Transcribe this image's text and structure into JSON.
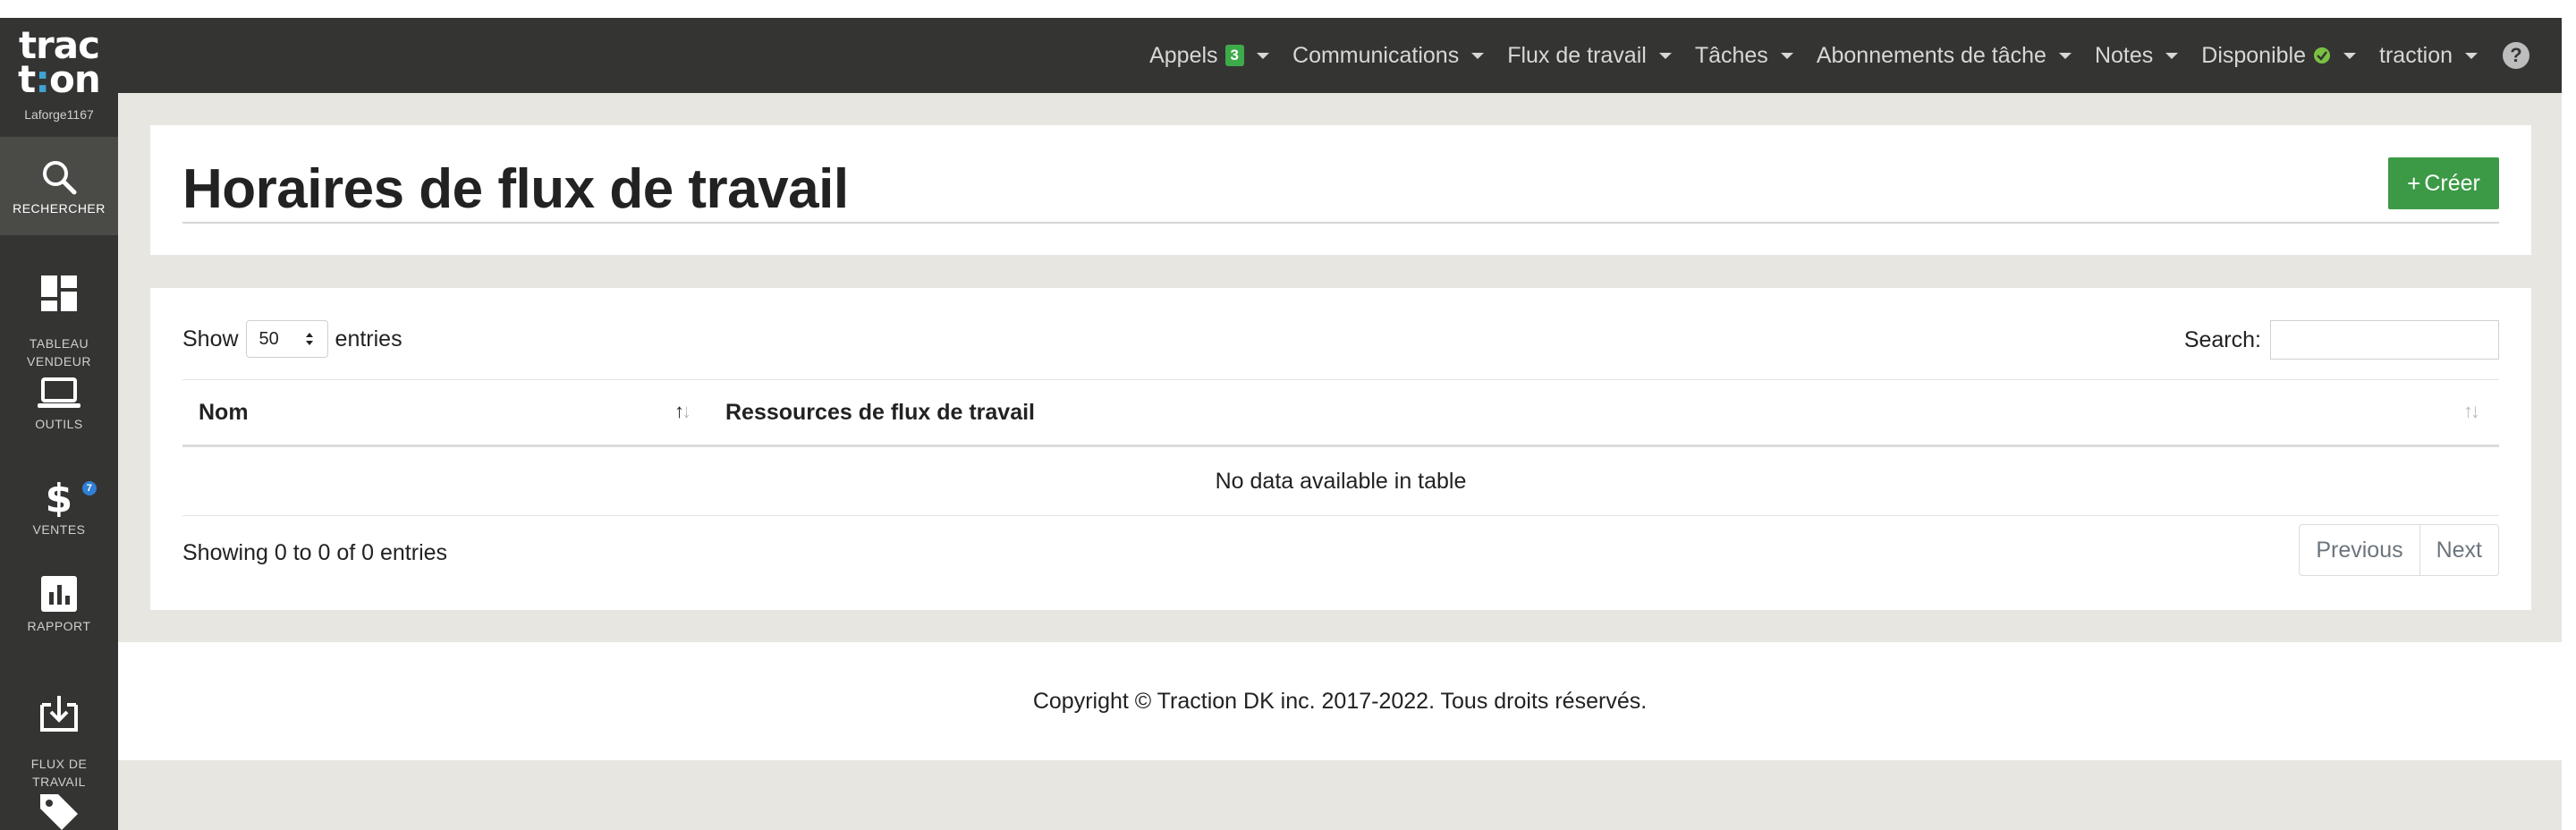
{
  "logo": {
    "line1": "trac",
    "line2a": "t",
    "line2b": ":",
    "line2c": "on",
    "username": "Laforge1167"
  },
  "sidebar": {
    "items": [
      {
        "label": "RECHERCHER",
        "icon": "search-icon",
        "active": true
      },
      {
        "label": "TABLEAU\nVENDEUR",
        "icon": "dashboard-icon"
      },
      {
        "label": "OUTILS",
        "icon": "laptop-icon"
      },
      {
        "label": "VENTES",
        "icon": "dollar-icon",
        "badge": "7"
      },
      {
        "label": "RAPPORT",
        "icon": "bar-chart-icon"
      },
      {
        "label": "FLUX DE\nTRAVAIL",
        "icon": "download-box-icon"
      },
      {
        "label": "",
        "icon": "tag-icon"
      }
    ]
  },
  "topnav": {
    "appels": "Appels",
    "appels_badge": "3",
    "communications": "Communications",
    "flux": "Flux de travail",
    "taches": "Tâches",
    "abonnements": "Abonnements de tâche",
    "notes": "Notes",
    "disponible": "Disponible",
    "user": "traction",
    "help": "?"
  },
  "header": {
    "title": "Horaires de flux de travail",
    "create_label": "Créer",
    "create_plus": "+"
  },
  "table": {
    "show_label": "Show",
    "entries_label": "entries",
    "page_length": "50",
    "search_label": "Search:",
    "search_value": "",
    "columns": [
      "Nom",
      "Ressources de flux de travail"
    ],
    "empty_message": "No data available in table",
    "info": "Showing 0 to 0 of 0 entries",
    "prev": "Previous",
    "next": "Next"
  },
  "footer": {
    "copyright": "Copyright © Traction DK inc. 2017-2022. Tous droits réservés."
  },
  "colors": {
    "sidebar_bg": "#343432",
    "create_btn": "#3c9a46",
    "badge_green": "#3eab4a",
    "badge_blue": "#2f7fd6",
    "logo_dot": "#3fa3d6"
  }
}
